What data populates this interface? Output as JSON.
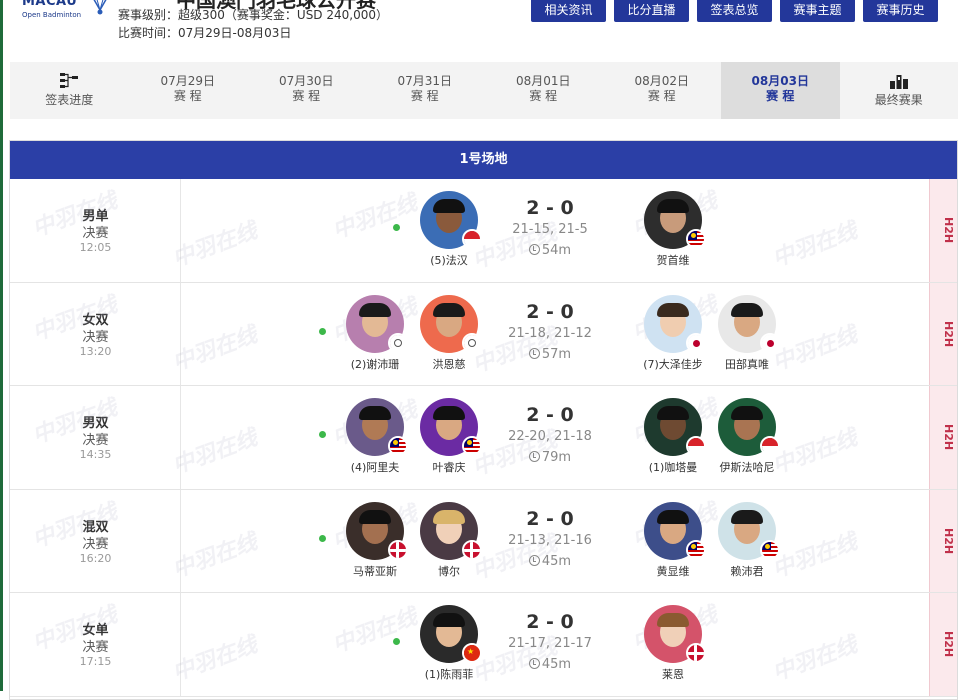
{
  "header": {
    "logo_text": "MACAU",
    "logo_sub": "Open Badminton",
    "event_title": "中国澳门羽毛球公开赛",
    "level_line": "赛事级别：超级300（赛事奖金：USD 240,000）",
    "time_line": "比赛时间：07月29日-08月03日",
    "buttons": [
      "相关资讯",
      "比分直播",
      "签表总览",
      "赛事主题",
      "赛事历史"
    ]
  },
  "tabs": [
    {
      "line1": "签表进度",
      "line2": "",
      "icon": "bracket-icon"
    },
    {
      "line1": "07月29日",
      "line2": "赛 程"
    },
    {
      "line1": "07月30日",
      "line2": "赛 程"
    },
    {
      "line1": "07月31日",
      "line2": "赛 程"
    },
    {
      "line1": "08月01日",
      "line2": "赛 程"
    },
    {
      "line1": "08月02日",
      "line2": "赛 程"
    },
    {
      "line1": "08月03日",
      "line2": "赛 程",
      "active": true
    },
    {
      "line1": "最终赛果",
      "line2": "",
      "icon": "podium-icon"
    }
  ],
  "court": {
    "title": "1号场地",
    "h2h_label": "H2H",
    "watermark": "中羽在线",
    "matches": [
      {
        "event": "男单",
        "round": "决赛",
        "time": "12:05",
        "score": "2 - 0",
        "games": "21-15, 21-5",
        "duration": "54m",
        "left": [
          {
            "name": "(5)法汉",
            "flag": "indonesia",
            "bg": "#3b6db5",
            "skin": "#8a5a3c",
            "hair": "#111"
          }
        ],
        "right": [
          {
            "name": "贺首维",
            "flag": "malaysia",
            "bg": "#2d2d2d",
            "skin": "#c89b7b",
            "hair": "#111"
          }
        ]
      },
      {
        "event": "女双",
        "round": "决赛",
        "time": "13:20",
        "score": "2 - 0",
        "games": "21-18, 21-12",
        "duration": "57m",
        "left": [
          {
            "name": "(2)谢沛珊",
            "flag": "chinese-taipei",
            "bg": "#b77fae",
            "skin": "#e3b995",
            "hair": "#1a1a1a"
          },
          {
            "name": "洪恩慈",
            "flag": "chinese-taipei",
            "bg": "#ee6a4d",
            "skin": "#d9a882",
            "hair": "#1a1a1a"
          }
        ],
        "right": [
          {
            "name": "(7)大泽佳步",
            "flag": "japan",
            "bg": "#cfe2f2",
            "skin": "#f0cdb0",
            "hair": "#3a2a1e"
          },
          {
            "name": "田部真唯",
            "flag": "japan",
            "bg": "#e8e8e8",
            "skin": "#d9a882",
            "hair": "#1a1a1a"
          }
        ]
      },
      {
        "event": "男双",
        "round": "决赛",
        "time": "14:35",
        "score": "2 - 0",
        "games": "22-20, 21-18",
        "duration": "79m",
        "left": [
          {
            "name": "(4)阿里夫",
            "flag": "malaysia",
            "bg": "#6a5a8a",
            "skin": "#b07a55",
            "hair": "#111"
          },
          {
            "name": "叶睿庆",
            "flag": "malaysia",
            "bg": "#6b2ba3",
            "skin": "#d9a882",
            "hair": "#111"
          }
        ],
        "right": [
          {
            "name": "(1)咖塔曼",
            "flag": "indonesia",
            "bg": "#1e3a2e",
            "skin": "#6e4a32",
            "hair": "#111"
          },
          {
            "name": "伊斯法哈尼",
            "flag": "indonesia",
            "bg": "#1d5c3a",
            "skin": "#a97452",
            "hair": "#111"
          }
        ]
      },
      {
        "event": "混双",
        "round": "决赛",
        "time": "16:20",
        "score": "2 - 0",
        "games": "21-13, 21-16",
        "duration": "45m",
        "left": [
          {
            "name": "马蒂亚斯",
            "flag": "denmark",
            "bg": "#3a2e2a",
            "skin": "#a37050",
            "hair": "#111"
          },
          {
            "name": "博尔",
            "flag": "denmark",
            "bg": "#4a3a44",
            "skin": "#f0d0b8",
            "hair": "#d9b46a"
          }
        ],
        "right": [
          {
            "name": "黄显维",
            "flag": "malaysia",
            "bg": "#3d4e8a",
            "skin": "#d9a882",
            "hair": "#111"
          },
          {
            "name": "赖沛君",
            "flag": "malaysia",
            "bg": "#cfe2e8",
            "skin": "#d9a882",
            "hair": "#1a1a1a"
          }
        ]
      },
      {
        "event": "女单",
        "round": "决赛",
        "time": "17:15",
        "score": "2 - 0",
        "games": "21-17, 21-17",
        "duration": "45m",
        "left": [
          {
            "name": "(1)陈雨菲",
            "flag": "china",
            "bg": "#2a2a2a",
            "skin": "#e3b995",
            "hair": "#111"
          }
        ],
        "right": [
          {
            "name": "莱恩",
            "flag": "denmark",
            "bg": "#d4536a",
            "skin": "#f0d0b8",
            "hair": "#8a5a30"
          }
        ]
      }
    ]
  },
  "colors": {
    "accent": "#2b3fa6",
    "button": "#23379a",
    "win_dot": "#3cb84a",
    "h2h": "#c0304a"
  }
}
